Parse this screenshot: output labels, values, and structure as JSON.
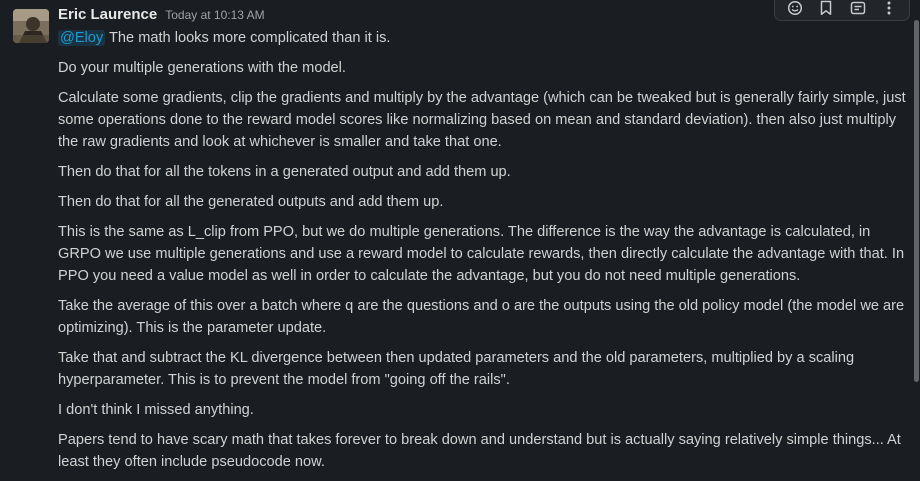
{
  "message": {
    "author": "Eric Laurence",
    "timestamp": "Today at 10:13 AM",
    "mention": "@Eloy",
    "first_line_rest": " The math looks more complicated than it is.",
    "paragraphs": [
      "Do your multiple generations with the model.",
      "Calculate some gradients, clip the gradients and multiply by the advantage (which can be tweaked but is generally fairly simple, just some operations done to the reward model scores like normalizing based on mean and standard deviation). then also just multiply the raw gradients and look at whichever is smaller and take that one.",
      "Then do that for all the tokens in a generated output and add them up.",
      "Then do that for all the generated outputs and add them up.",
      "This is the same as L_clip from PPO, but we do multiple generations. The difference is the way the advantage is calculated, in GRPO we use multiple generations and use a reward model to calculate rewards, then directly calculate the advantage with that. In PPO you need a value model as well in order to calculate the advantage, but you do not need multiple generations.",
      "Take the average of this over a batch where q are the questions and o are the outputs using the old policy model (the model we are optimizing). This is the parameter update.",
      "Take that and subtract the KL divergence between then updated parameters and the old parameters, multiplied by a scaling hyperparameter. This is to prevent the model from \"going off the rails\".",
      "I don't think I missed anything.",
      "Papers tend to have scary math that takes forever to break down and understand but is actually saying relatively simple things... At least they often include pseudocode now."
    ]
  },
  "actions": [
    {
      "icon": "add-reaction-icon"
    },
    {
      "icon": "bookmark-icon"
    },
    {
      "icon": "save-for-later-icon"
    },
    {
      "icon": "more-actions-icon"
    }
  ],
  "colors": {
    "background": "#1a1d21",
    "text": "#d1d2d3",
    "mention": "#1d9bd1"
  }
}
